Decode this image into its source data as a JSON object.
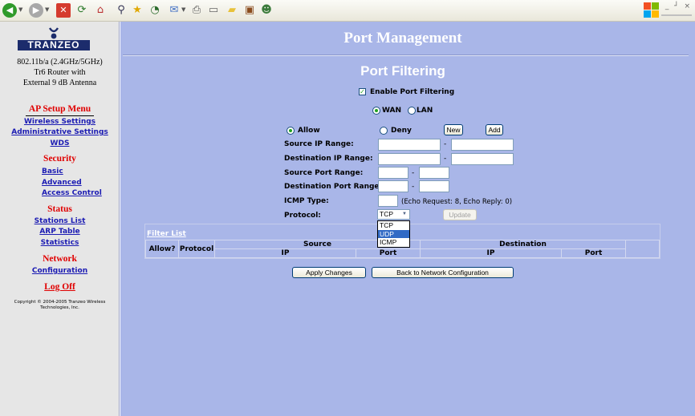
{
  "window": {
    "controls": "_ ┘ ×"
  },
  "sidebar": {
    "logo": "TRANZEO",
    "desc_line1": "802.11b/a (2.4GHz/5GHz)",
    "desc_line2": "Tr6 Router with",
    "desc_line3": "External 9 dB Antenna",
    "ap_menu_title": "AP Setup Menu",
    "ap_links": [
      "Wireless Settings",
      "Administrative Settings",
      "WDS"
    ],
    "security_title": "Security",
    "security_links": [
      "Basic",
      "Advanced",
      "Access Control"
    ],
    "status_title": "Status",
    "status_links": [
      "Stations List",
      "ARP Table",
      "Statistics"
    ],
    "network_title": "Network",
    "network_links": [
      "Configuration"
    ],
    "logoff": "Log Off",
    "copyright_line1": "Copyright © 2004-2005 Tranzeo Wireless",
    "copyright_line2": "Technologies, Inc."
  },
  "main": {
    "title": "Port Management",
    "subtitle": "Port Filtering",
    "enable_label": "Enable Port Filtering",
    "wan_label": "WAN",
    "lan_label": "LAN",
    "allow_label": "Allow",
    "deny_label": "Deny",
    "new_button": "New",
    "add_button": "Add",
    "source_ip_label": "Source IP Range:",
    "dest_ip_label": "Destination IP Range:",
    "source_port_label": "Source Port Range:",
    "dest_port_label": "Destination Port Range:",
    "icmp_label": "ICMP Type:",
    "icmp_hint": "(Echo Request: 8, Echo Reply: 0)",
    "protocol_label": "Protocol:",
    "protocol_selected": "TCP",
    "protocol_options": [
      "TCP",
      "UDP",
      "ICMP"
    ],
    "update_button": "Update",
    "filter_list_link": "Filter List",
    "table": {
      "allow_header": "Allow?",
      "protocol_header": "Protocol",
      "source_header": "Source",
      "destination_header": "Destination",
      "ip_header": "IP",
      "port_header": "Port"
    },
    "apply_button": "Apply Changes",
    "back_button": "Back to Network Configuration"
  }
}
